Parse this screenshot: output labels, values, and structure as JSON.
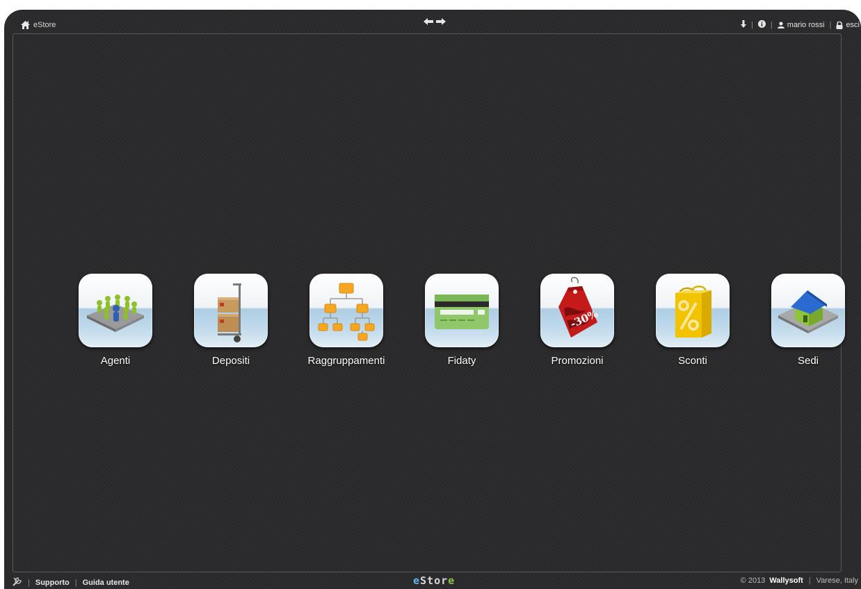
{
  "header": {
    "home_label": "eStore",
    "user_name": "mario rossi",
    "logout_label": "esci"
  },
  "apps": [
    {
      "label": "Agenti",
      "icon": "agents-icon"
    },
    {
      "label": "Depositi",
      "icon": "warehouse-cart-icon"
    },
    {
      "label": "Raggruppamenti",
      "icon": "hierarchy-icon"
    },
    {
      "label": "Fidaty",
      "icon": "credit-card-icon"
    },
    {
      "label": "Promozioni",
      "icon": "promo-tag-icon"
    },
    {
      "label": "Sconti",
      "icon": "discount-bag-icon"
    },
    {
      "label": "Sedi",
      "icon": "house-icon"
    }
  ],
  "footer": {
    "support_label": "Supporto",
    "guide_label": "Guida utente",
    "logo": {
      "e1": "e",
      "mid": "Stor",
      "e2": "e"
    },
    "copyright_prefix": "© 2013",
    "company": "Wallysoft",
    "location": "Varese, Italy"
  },
  "colors": {
    "background": "#2b2b2d",
    "logo_blue": "#5fb7e8",
    "logo_green": "#86c74a"
  }
}
